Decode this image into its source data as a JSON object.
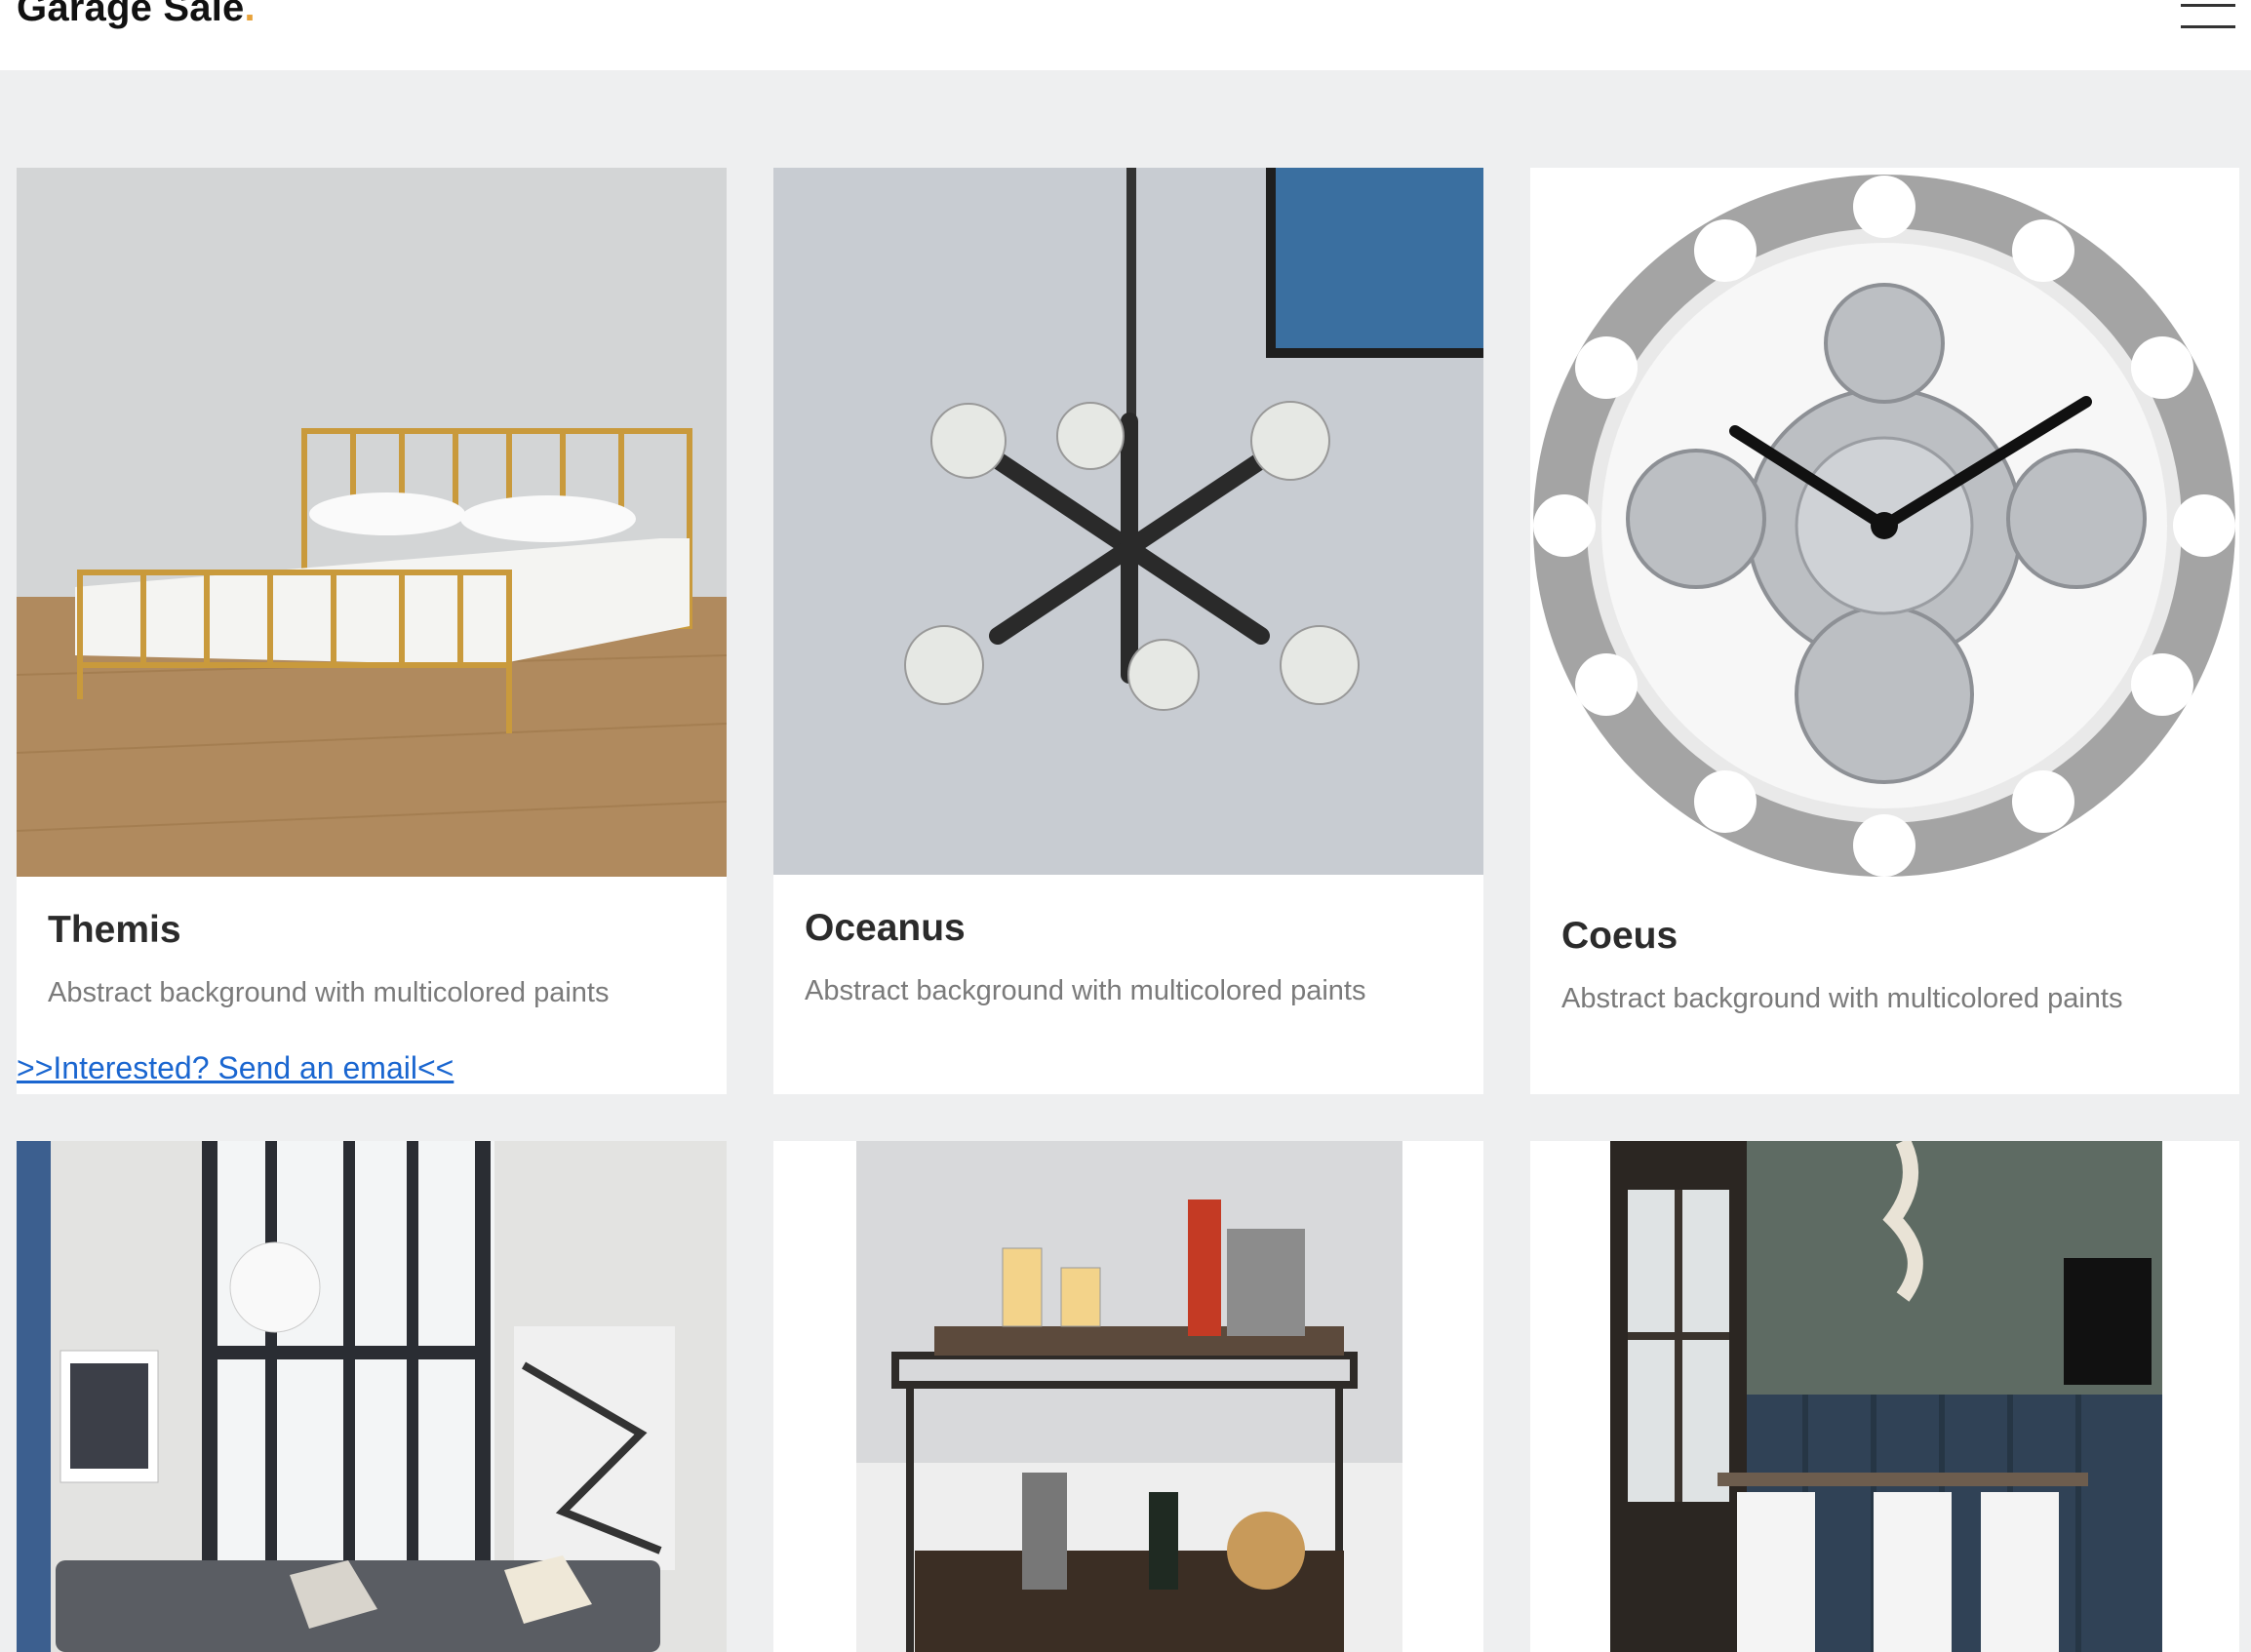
{
  "header": {
    "brand": "Garage Sale",
    "brand_dot": ".",
    "menu_icon": "hamburger-menu-icon"
  },
  "colors": {
    "accent": "#e8a33a",
    "link": "#1a66d0",
    "background": "#eeeff0"
  },
  "products": [
    {
      "title": "Themis",
      "description": "Abstract background with multicolored paints",
      "link": ">>Interested? Send an email<<",
      "image": "brass-bed-photo"
    },
    {
      "title": "Oceanus",
      "description": "Abstract background with multicolored paints",
      "image": "pendant-light-photo"
    },
    {
      "title": "Coeus",
      "description": "Abstract background with multicolored paints",
      "image": "gear-wall-clock-photo"
    },
    {
      "image": "living-room-photo"
    },
    {
      "image": "bar-cart-photo"
    },
    {
      "image": "dining-nook-photo"
    }
  ]
}
